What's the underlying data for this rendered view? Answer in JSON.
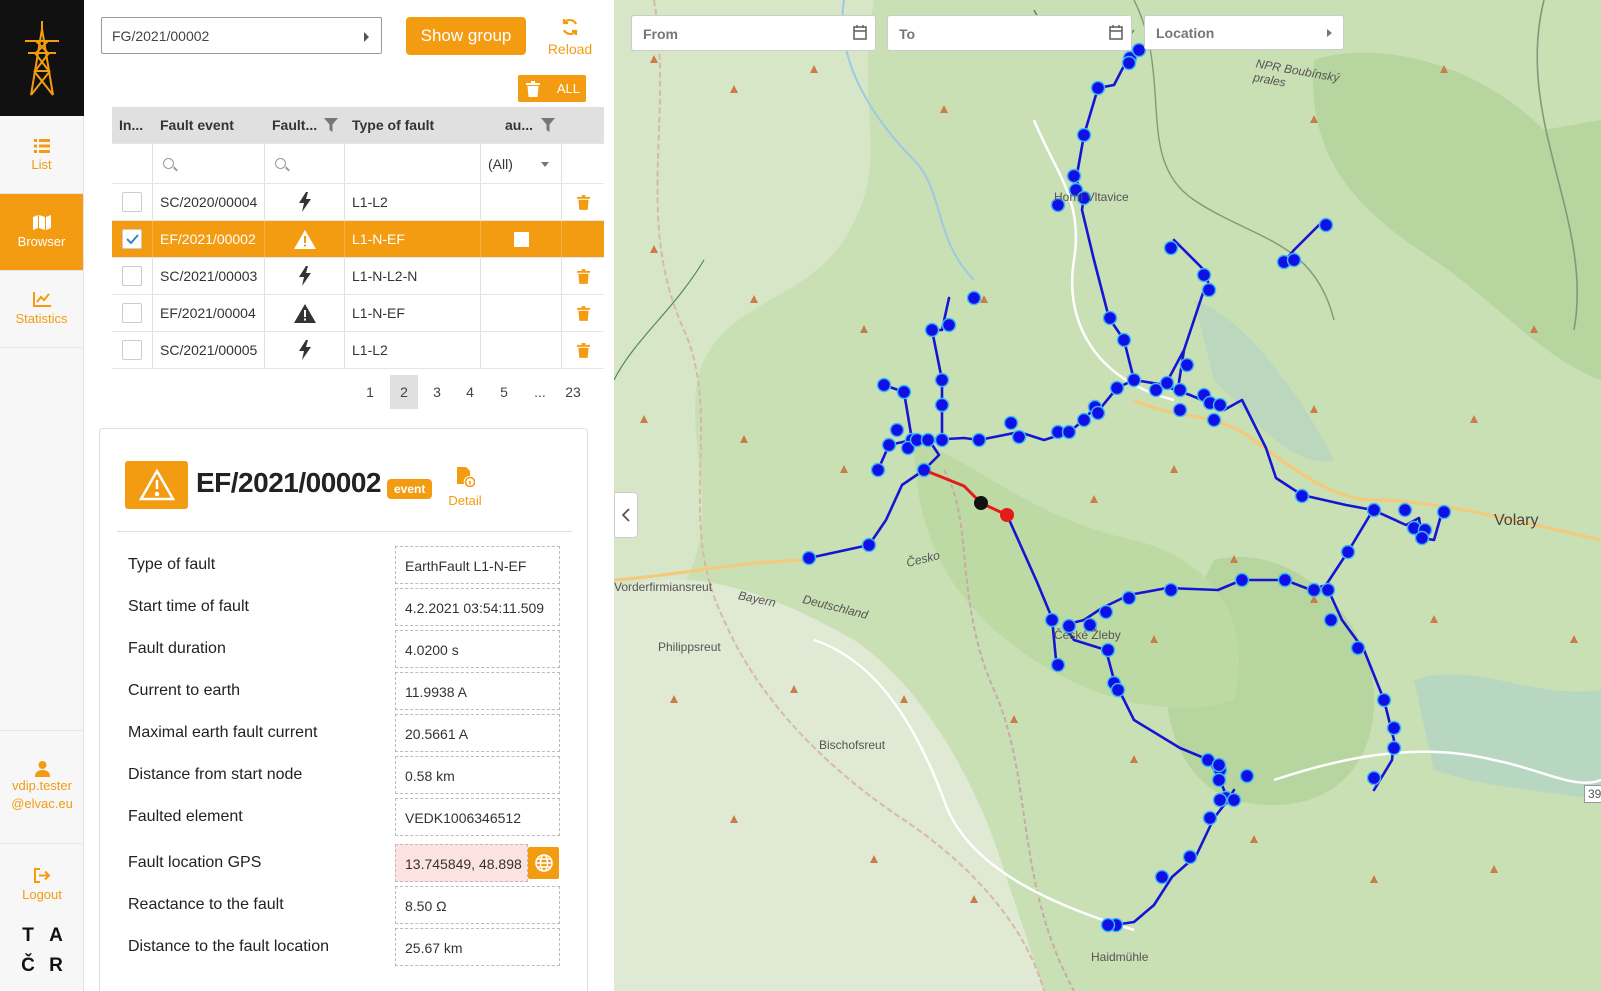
{
  "nav": {
    "list": "List",
    "browser": "Browser",
    "statistics": "Statistics",
    "user": "vdip.tester@elvac.eu",
    "logout": "Logout",
    "tacr": [
      "T",
      "A",
      "Č",
      "R"
    ]
  },
  "toolbar": {
    "group_value": "FG/2021/00002",
    "show_group": "Show group",
    "reload": "Reload",
    "delete_all": "ALL"
  },
  "grid": {
    "headers": [
      "In...",
      "Fault event",
      "Fault...",
      "Type of fault",
      "au..."
    ],
    "aut_filter": "(All)",
    "rows": [
      {
        "event": "SC/2020/00004",
        "icon": "bolt",
        "type": "L1-L2",
        "checked": false,
        "selected": false
      },
      {
        "event": "EF/2021/00002",
        "icon": "warning",
        "type": "L1-N-EF",
        "checked": true,
        "selected": true
      },
      {
        "event": "SC/2021/00003",
        "icon": "bolt",
        "type": "L1-N-L2-N",
        "checked": false,
        "selected": false
      },
      {
        "event": "EF/2021/00004",
        "icon": "warning",
        "type": "L1-N-EF",
        "checked": false,
        "selected": false
      },
      {
        "event": "SC/2021/00005",
        "icon": "bolt",
        "type": "L1-L2",
        "checked": false,
        "selected": false
      }
    ]
  },
  "pager": {
    "pages": [
      "1",
      "2",
      "3",
      "4",
      "5",
      "...",
      "23"
    ],
    "active": "2"
  },
  "detail": {
    "title": "EF/2021/00002",
    "badge": "event",
    "detail_label": "Detail",
    "props": [
      {
        "label": "Type of fault",
        "value": "EarthFault L1-N-EF"
      },
      {
        "label": "Start time of fault",
        "value": "4.2.2021 03:54:11.509"
      },
      {
        "label": "Fault duration",
        "value": "4.0200 s"
      },
      {
        "label": "Current to earth",
        "value": "11.9938 A"
      },
      {
        "label": "Maximal earth fault current",
        "value": "20.5661 A"
      },
      {
        "label": "Distance from start node",
        "value": "0.58 km"
      },
      {
        "label": "Faulted element",
        "value": "VEDK1006346512"
      },
      {
        "label": "Fault location GPS",
        "value": "13.745849, 48.898"
      },
      {
        "label": "Reactance to the fault",
        "value": "8.50 Ω"
      },
      {
        "label": "Distance to the fault location",
        "value": "25.67 km"
      }
    ]
  },
  "map": {
    "from": "From",
    "to": "To",
    "location": "Location",
    "labels": [
      "Volary",
      "Bayern",
      "Deutschland",
      "Philippsreut",
      "Vorderfirmiansreut",
      "Bischofsreut",
      "Haidmühle",
      "Horní Vltavice",
      "České Žleby",
      "NPR Boubínský prales",
      "Česko",
      "39"
    ]
  },
  "colors": {
    "accent": "#f39c12",
    "network": "#1010d8",
    "fault": "#e21b1b"
  }
}
